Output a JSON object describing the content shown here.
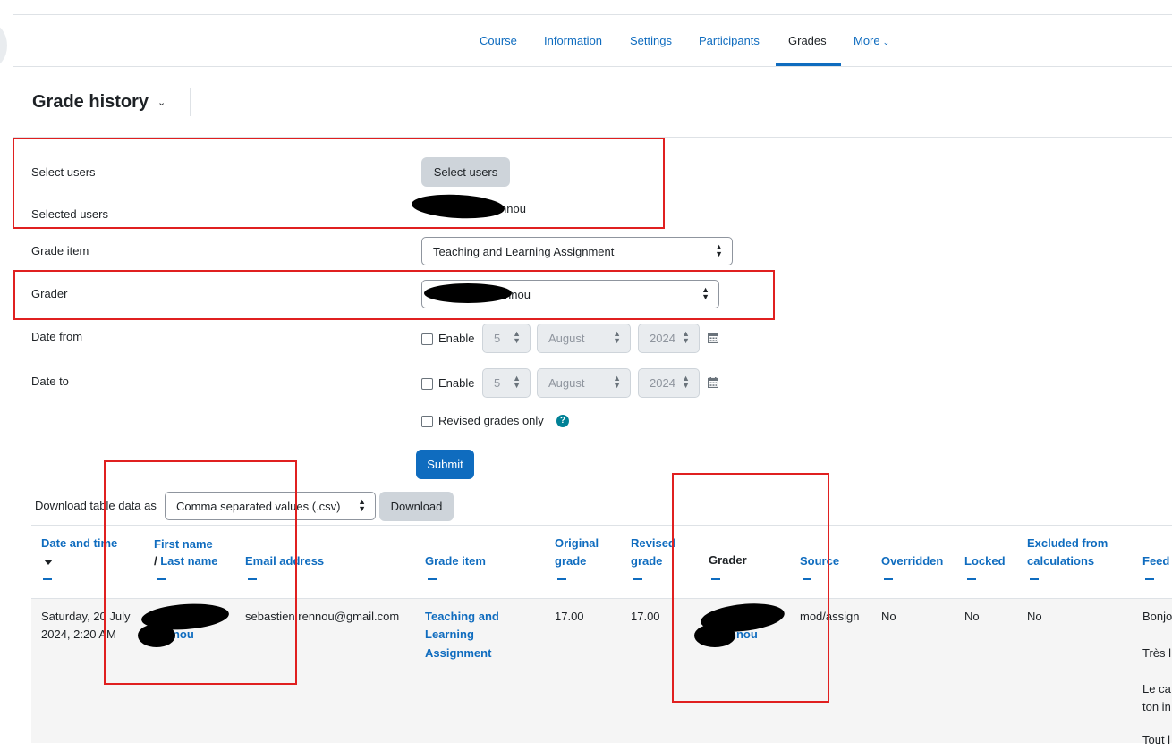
{
  "nav": {
    "items": [
      {
        "label": "Course"
      },
      {
        "label": "Information"
      },
      {
        "label": "Settings"
      },
      {
        "label": "Participants"
      },
      {
        "label": "Grades"
      },
      {
        "label": "More"
      }
    ],
    "active": "Grades"
  },
  "page": {
    "title": "Grade history"
  },
  "form": {
    "select_users_label": "Select users",
    "select_users_button": "Select users",
    "selected_users_label": "Selected users",
    "selected_users_value_visible": "nnou",
    "grade_item_label": "Grade item",
    "grade_item_value": "Teaching and Learning Assignment",
    "grader_label": "Grader",
    "grader_value_visible": "nnou",
    "date_from_label": "Date from",
    "date_to_label": "Date to",
    "enable_label": "Enable",
    "day": "5",
    "month": "August",
    "year": "2024",
    "revised_only_label": "Revised grades only",
    "submit_label": "Submit"
  },
  "download": {
    "label": "Download table data as",
    "format": "Comma separated values (.csv)",
    "button": "Download"
  },
  "table": {
    "headers": {
      "date_time": "Date and time",
      "first_name": "First name",
      "last_name": "Last name",
      "email": "Email address",
      "grade_item": "Grade item",
      "original_grade_1": "Original",
      "original_grade_2": "grade",
      "revised_grade_1": "Revised",
      "revised_grade_2": "grade",
      "grader": "Grader",
      "source": "Source",
      "overridden": "Overridden",
      "locked": "Locked",
      "excluded_1": "Excluded from",
      "excluded_2": "calculations",
      "feedback": "Feed"
    },
    "row": {
      "date_line1": "Saturday, 20 July",
      "date_line2": "2024, 2:20 AM",
      "name_visible": "nnou",
      "email": "sebastien.rennou@gmail.com",
      "grade_item_1": "Teaching and",
      "grade_item_2": "Learning",
      "grade_item_3": "Assignment",
      "original_grade": "17.00",
      "revised_grade": "17.00",
      "grader_visible": "nnou",
      "source": "mod/assign",
      "overridden": "No",
      "locked": "No",
      "excluded": "No",
      "feedback_1": "Bonjo",
      "feedback_2": "Très l",
      "feedback_3": "Le ca",
      "feedback_4": "ton in",
      "feedback_5": "Tout l"
    }
  },
  "colors": {
    "accent": "#0f6cbf",
    "annotation": "#e02020"
  }
}
